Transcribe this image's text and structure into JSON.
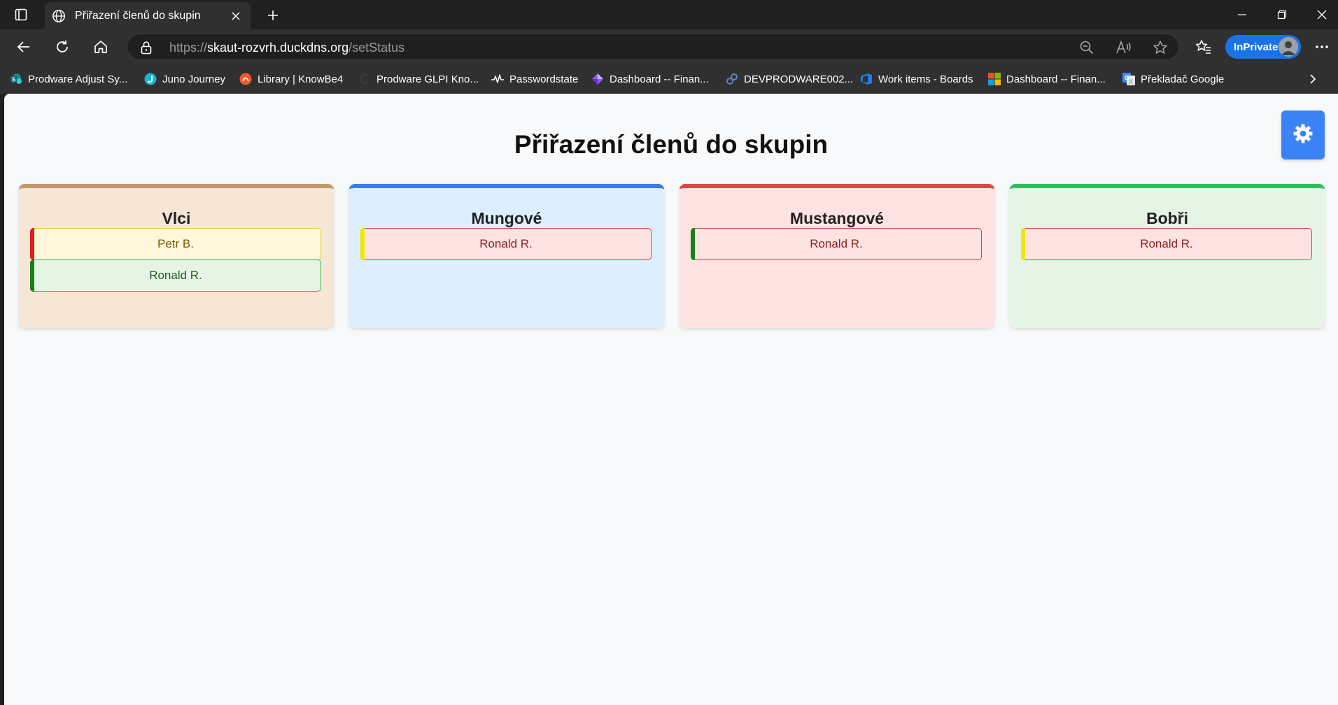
{
  "browser": {
    "tab": {
      "title": "Přiřazení členů do skupin"
    },
    "address": {
      "protocol": "https://",
      "host": "skaut-rozvrh.duckdns.org",
      "path": "/setStatus"
    },
    "inprivate_label": "InPrivate",
    "favorites": [
      {
        "label": "Prodware Adjust Sy...",
        "icon": "sharepoint-icon"
      },
      {
        "label": "Juno Journey",
        "icon": "juno-icon"
      },
      {
        "label": "Library | KnowBe4",
        "icon": "knowbe4-icon"
      },
      {
        "label": "Prodware GLPI Kno...",
        "icon": "glpi-icon"
      },
      {
        "label": "Passwordstate",
        "icon": "pulse-icon"
      },
      {
        "label": "Dashboard -- Finan...",
        "icon": "powerapps-icon"
      },
      {
        "label": "DEVPRODWARE002...",
        "icon": "dev-icon"
      },
      {
        "label": "Work items - Boards",
        "icon": "azure-devops-icon"
      },
      {
        "label": "Dashboard -- Finan...",
        "icon": "microsoft-icon"
      },
      {
        "label": "Překladač Google",
        "icon": "google-translate-icon"
      }
    ]
  },
  "page": {
    "title": "Přiřazení členů do skupin",
    "groups": [
      {
        "name": "Vlci",
        "accent": "#c49a6c",
        "background": "#f5e6d5",
        "members": [
          {
            "name": "Petr B.",
            "status_color": "#e11d1d",
            "bg": "#fff7dc",
            "border": "#e8c94a",
            "text": "#7a5a00"
          },
          {
            "name": "Ronald R.",
            "status_color": "#1a7f1a",
            "bg": "#e6f4e6",
            "border": "#48b048",
            "text": "#1f5e1f"
          }
        ]
      },
      {
        "name": "Mungové",
        "accent": "#3b7de8",
        "background": "#ddeefe",
        "members": [
          {
            "name": "Ronald R.",
            "status_color": "#f2e600",
            "bg": "#ffe3e3",
            "border": "#d04a4a",
            "text": "#8b1f1f"
          }
        ]
      },
      {
        "name": "Mustangové",
        "accent": "#e04545",
        "background": "#ffe3e3",
        "members": [
          {
            "name": "Ronald R.",
            "status_color": "#1a7f1a",
            "bg": "#ffe3e3",
            "border": "#d04a4a",
            "text": "#8b1f1f"
          }
        ]
      },
      {
        "name": "Bobři",
        "accent": "#2fc05a",
        "background": "#e6f4e6",
        "members": [
          {
            "name": "Ronald R.",
            "status_color": "#f2e600",
            "bg": "#ffe3e3",
            "border": "#d04a4a",
            "text": "#8b1f1f"
          }
        ]
      }
    ]
  }
}
